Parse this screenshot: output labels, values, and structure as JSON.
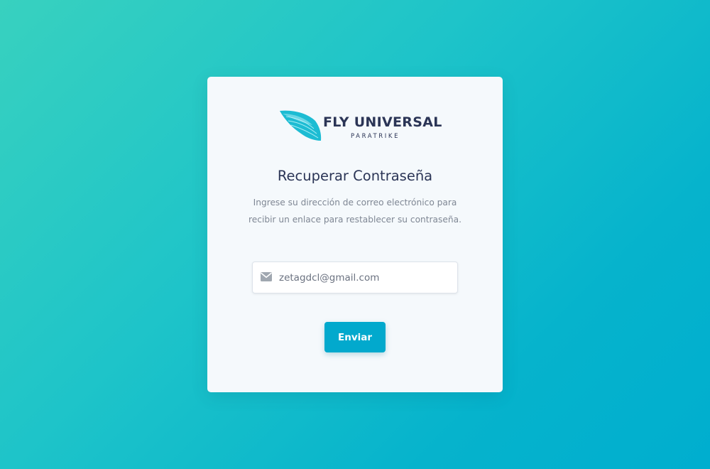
{
  "brand": {
    "name": "FLY UNIVERSAL",
    "tagline": "PARATRIKE",
    "logo_icon": "wing-logo-icon",
    "colors": {
      "wing_primary": "#1dbcd3",
      "wing_secondary": "#8fe3ee",
      "text": "#2b3556"
    }
  },
  "form": {
    "title": "Recuperar Contraseña",
    "description": "Ingrese su dirección de correo electrónico para recibir un enlace para restablecer su contraseña.",
    "email": {
      "icon": "envelope-icon",
      "value": "zetagdcl@gmail.com"
    },
    "submit_label": "Enviar"
  },
  "colors": {
    "background_start": "#38d1bf",
    "background_end": "#00aecf",
    "card": "#f5f9fc",
    "button": "#02a9cd"
  }
}
